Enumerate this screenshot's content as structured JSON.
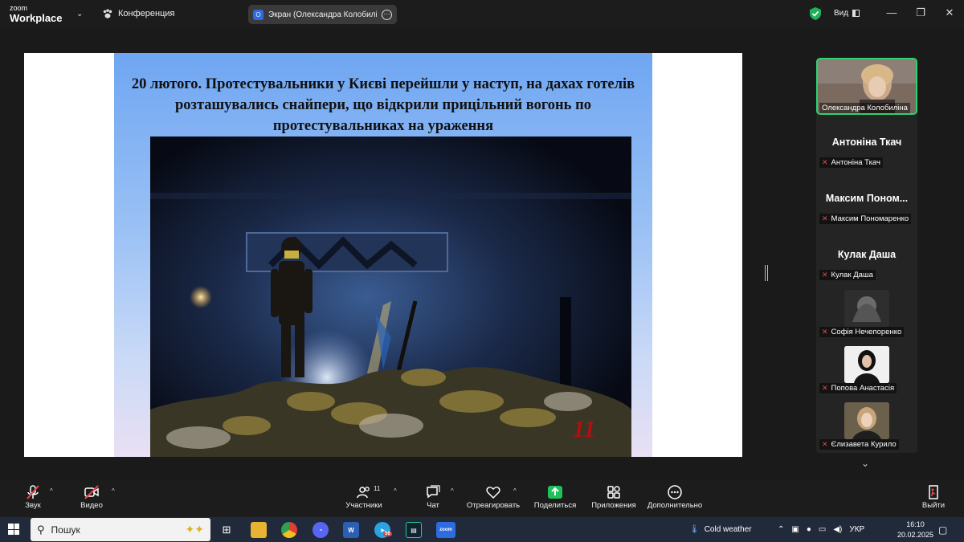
{
  "app": {
    "logo_line1": "zoom",
    "logo_line2": "Workplace",
    "meeting_label": "Конференция",
    "share_label": "Экран (Олександра Колобиліна",
    "view_label": "Вид"
  },
  "slide": {
    "title": "20 лютого. Протестувальники у Києві перейшли у наступ, на дахах готелів розташувались снайпери, що відкрили прицільний вогонь по протестувальниках на ураження",
    "page_number": "11"
  },
  "participants": {
    "active_name": "Олександра Колобиліна",
    "tiles": [
      {
        "big": "Антоніна Ткач",
        "label": "Антоніна Ткач"
      },
      {
        "big": "Максим Поном...",
        "label": "Максим Пономаренко"
      },
      {
        "big": "Кулак Даша",
        "label": "Кулак Даша"
      },
      {
        "label": "Софія Нечепоренко"
      },
      {
        "label": "Попова Анастасія"
      },
      {
        "label": "Єлизавета Курило"
      }
    ]
  },
  "toolbar": {
    "audio": "Звук",
    "video": "Видео",
    "participants": "Участники",
    "participants_count": "11",
    "chat": "Чат",
    "react": "Отреагировать",
    "share": "Поделиться",
    "apps": "Приложения",
    "more": "Дополнительно",
    "leave": "Выйти"
  },
  "taskbar": {
    "search_placeholder": "Пошук",
    "weather": "Cold weather",
    "lang": "УКР",
    "time": "16:10",
    "date": "20.02.2025",
    "telegram_badge": "56"
  },
  "colors": {
    "active_border": "#2fd170",
    "mic_off": "#e5484d",
    "page_number": "#b01010",
    "share_green": "#1fc25a"
  }
}
